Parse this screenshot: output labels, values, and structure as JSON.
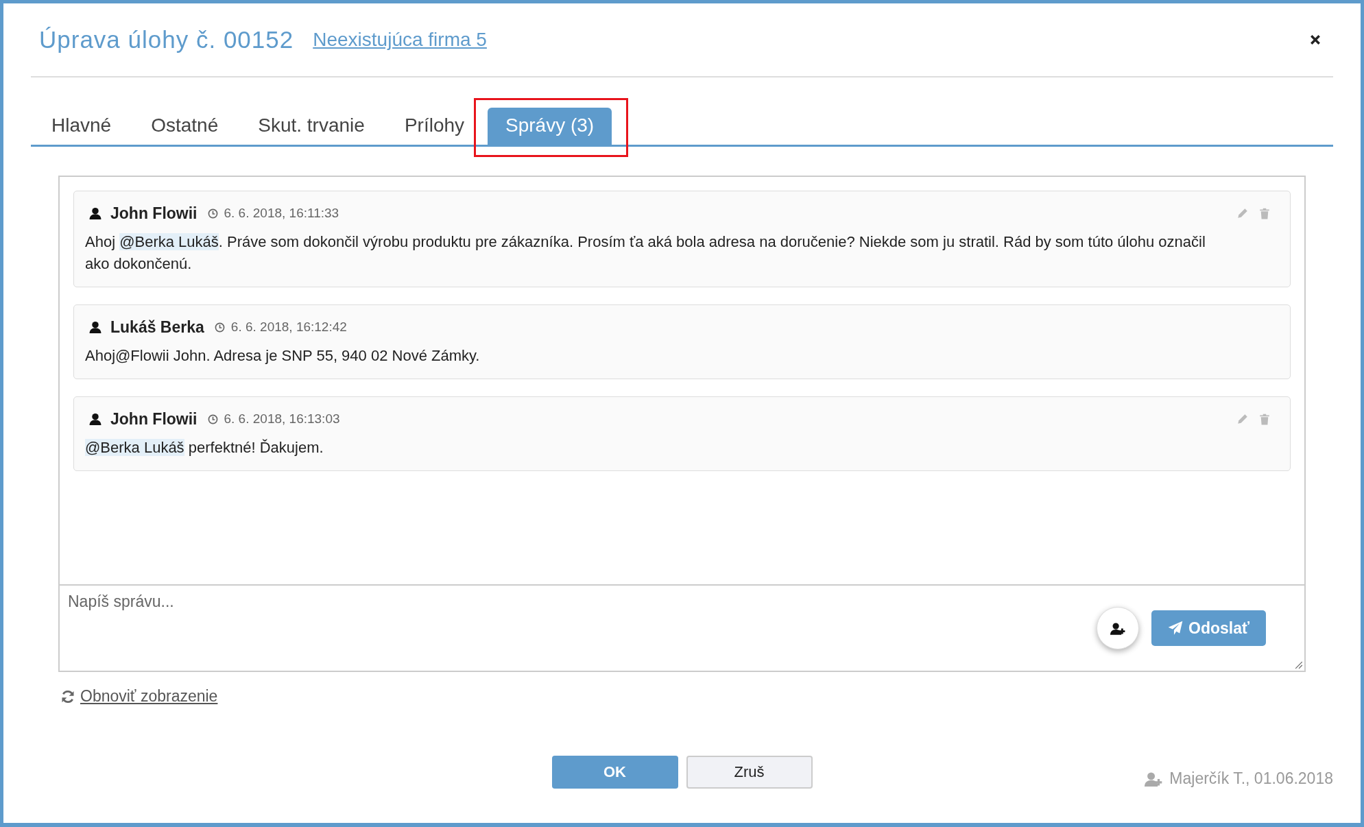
{
  "dialog": {
    "title": "Úprava úlohy č. 00152",
    "company_link": "Neexistujúca firma 5"
  },
  "tabs": [
    {
      "label": "Hlavné",
      "selected": false,
      "highlighted": false
    },
    {
      "label": "Ostatné",
      "selected": false,
      "highlighted": false
    },
    {
      "label": "Skut. trvanie",
      "selected": false,
      "highlighted": false
    },
    {
      "label": "Prílohy",
      "selected": false,
      "highlighted": false
    },
    {
      "label": "Správy (3)",
      "selected": true,
      "highlighted": true
    }
  ],
  "messages": [
    {
      "author": "John Flowii",
      "time": "6. 6. 2018, 16:11:33",
      "editable": true,
      "body": [
        {
          "kind": "text",
          "text": "Ahoj "
        },
        {
          "kind": "mention",
          "text": "@Berka Lukáš"
        },
        {
          "kind": "text",
          "text": ". Práve som dokončil výrobu produktu pre zákazníka. Prosím ťa aká bola adresa na doručenie? Niekde som ju stratil. Rád by som túto úlohu označil ako dokončenú."
        }
      ]
    },
    {
      "author": "Lukáš Berka",
      "time": "6. 6. 2018, 16:12:42",
      "editable": false,
      "body": [
        {
          "kind": "text",
          "text": "Ahoj@Flowii John. Adresa je SNP 55, 940 02 Nové Zámky."
        }
      ]
    },
    {
      "author": "John Flowii",
      "time": "6. 6. 2018, 16:13:03",
      "editable": true,
      "body": [
        {
          "kind": "mention",
          "text": "@Berka Lukáš"
        },
        {
          "kind": "text",
          "text": " perfektné! Ďakujem."
        }
      ]
    }
  ],
  "composer": {
    "placeholder": "Napíš správu...",
    "send_button": "Odoslať"
  },
  "refresh_link": "Obnoviť zobrazenie",
  "buttons": {
    "ok": "OK",
    "cancel": "Zruš"
  },
  "footer_info": "Majerčík T., 01.06.2018"
}
